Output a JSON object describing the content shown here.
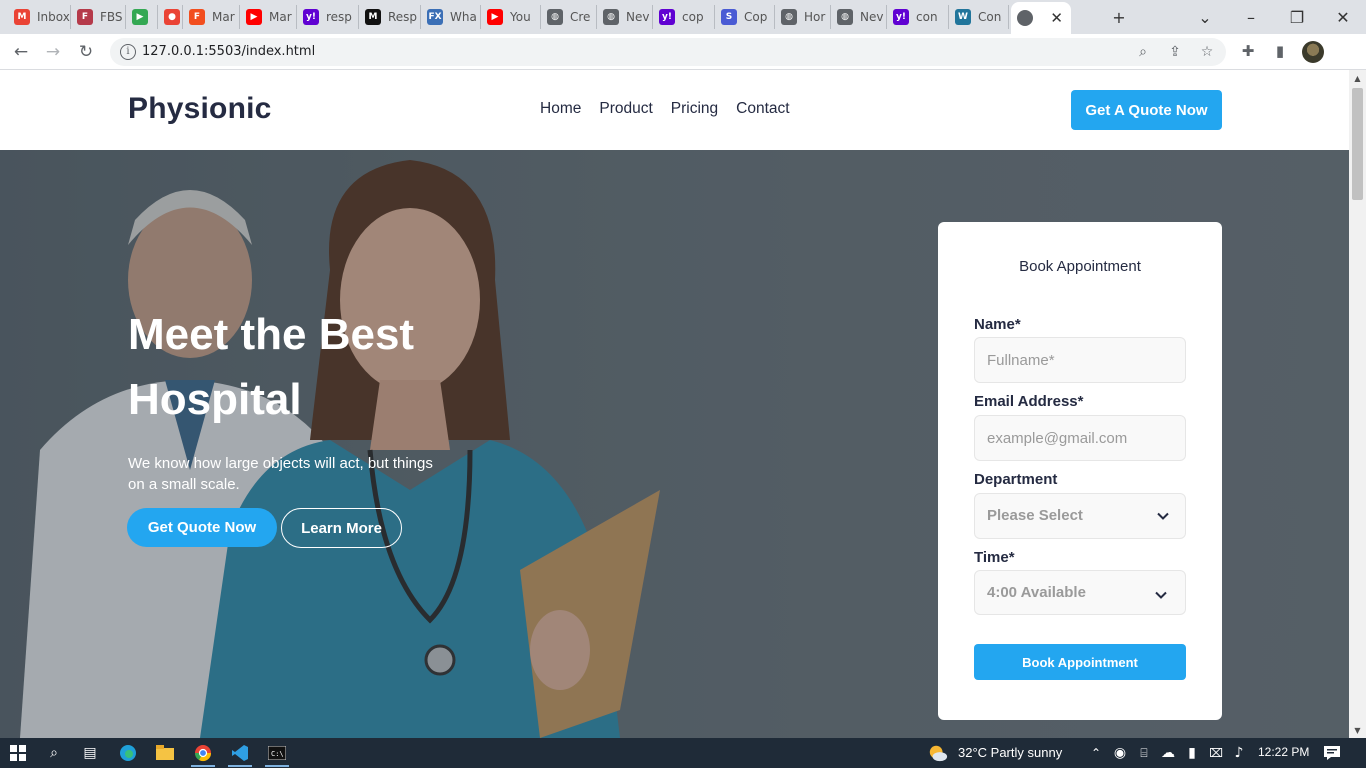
{
  "browser": {
    "tabs": [
      {
        "label": "Inbox",
        "icon": "gmail-icon",
        "color": "#ea4335",
        "glyph": "M"
      },
      {
        "label": "FBS",
        "icon": "fbs-icon",
        "color": "#b53a4a",
        "glyph": "F"
      },
      {
        "label": "",
        "icon": "meet-icon",
        "color": "#34a853",
        "glyph": "▶"
      },
      {
        "label": "",
        "icon": "record-icon",
        "color": "#ea4335",
        "glyph": "●"
      },
      {
        "label": "Mar",
        "icon": "figma-icon",
        "color": "#f24e1e",
        "glyph": "F"
      },
      {
        "label": "Mar",
        "icon": "youtube-icon",
        "color": "#ff0000",
        "glyph": "▶"
      },
      {
        "label": "resp",
        "icon": "yahoo-icon",
        "color": "#6001d2",
        "glyph": "y!"
      },
      {
        "label": "Resp",
        "icon": "medium-icon",
        "color": "#111111",
        "glyph": "M"
      },
      {
        "label": "Wha",
        "icon": "fx-icon",
        "color": "#3b6fb6",
        "glyph": "FX"
      },
      {
        "label": "You",
        "icon": "youtube-icon",
        "color": "#ff0000",
        "glyph": "▶"
      },
      {
        "label": "Cre",
        "icon": "globe-icon",
        "color": "#5f6368",
        "glyph": "◍"
      },
      {
        "label": "Nev",
        "icon": "globe-icon",
        "color": "#5f6368",
        "glyph": "◍"
      },
      {
        "label": "cop",
        "icon": "yahoo-icon",
        "color": "#6001d2",
        "glyph": "y!"
      },
      {
        "label": "Cop",
        "icon": "s-icon",
        "color": "#4a5bd4",
        "glyph": "S"
      },
      {
        "label": "Hor",
        "icon": "globe-icon",
        "color": "#5f6368",
        "glyph": "◍"
      },
      {
        "label": "Nev",
        "icon": "globe-icon",
        "color": "#5f6368",
        "glyph": "◍"
      },
      {
        "label": "con",
        "icon": "yahoo-icon",
        "color": "#6001d2",
        "glyph": "y!"
      },
      {
        "label": "Con",
        "icon": "wordpress-icon",
        "color": "#21759b",
        "glyph": "W"
      }
    ],
    "url": "127.0.0.1:5503/index.html"
  },
  "site": {
    "logo": "Physionic",
    "nav": [
      "Home",
      "Product",
      "Pricing",
      "Contact"
    ],
    "header_cta": "Get A Quote Now",
    "hero": {
      "title": "Meet the Best Hospital",
      "subtitle": "We know how large objects will act, but things on a small scale.",
      "primary_cta": "Get Quote Now",
      "secondary_cta": "Learn More"
    },
    "form": {
      "title": "Book Appointment",
      "name_label": "Name*",
      "name_placeholder": "Fullname*",
      "email_label": "Email Address*",
      "email_placeholder": "example@gmail.com",
      "department_label": "Department",
      "department_value": "Please Select",
      "time_label": "Time*",
      "time_value": "4:00 Available",
      "submit": "Book Appointment"
    }
  },
  "taskbar": {
    "weather": "32°C  Partly sunny",
    "time": "12:22 PM"
  },
  "colors": {
    "accent": "#23a6f0",
    "heading": "#252b42"
  }
}
